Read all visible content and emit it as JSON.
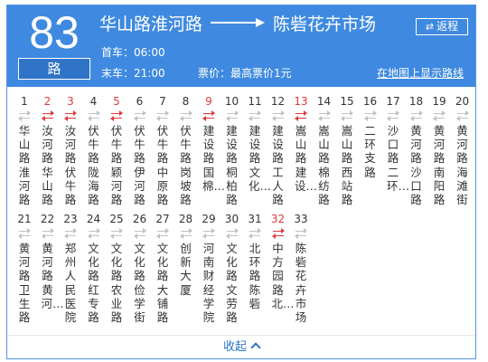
{
  "route": {
    "number": "83",
    "unit": "路",
    "from": "华山路淮河路",
    "to": "陈砦花卉市场",
    "first_bus_label": "首车：",
    "first_bus_time": "06:00",
    "last_bus_label": "末车：",
    "last_bus_time": "21:00",
    "fare_label": "票价：",
    "fare_value": "最高票价1元",
    "return_label": "返程",
    "map_link": "在地图上显示路线"
  },
  "stops": [
    {
      "num": "1",
      "name": "华山路淮河路",
      "highlight": false
    },
    {
      "num": "2",
      "name": "汝河路华山路",
      "highlight": true
    },
    {
      "num": "3",
      "name": "汝河路伏牛路",
      "highlight": true
    },
    {
      "num": "4",
      "name": "伏牛路陇海路",
      "highlight": false
    },
    {
      "num": "5",
      "name": "伏牛路颖河路",
      "highlight": true
    },
    {
      "num": "6",
      "name": "伏牛路伊河路",
      "highlight": false
    },
    {
      "num": "7",
      "name": "伏牛路中原路",
      "highlight": false
    },
    {
      "num": "8",
      "name": "伏牛路岗坡路",
      "highlight": false
    },
    {
      "num": "9",
      "name": "建设路国棉…",
      "highlight": true
    },
    {
      "num": "10",
      "name": "建设路桐柏路",
      "highlight": false
    },
    {
      "num": "11",
      "name": "建设路文化…",
      "highlight": false
    },
    {
      "num": "12",
      "name": "建设路工人路",
      "highlight": false
    },
    {
      "num": "13",
      "name": "嵩山路建设…",
      "highlight": true
    },
    {
      "num": "14",
      "name": "嵩山路棉纺路",
      "highlight": false
    },
    {
      "num": "15",
      "name": "嵩山路西站路",
      "highlight": false
    },
    {
      "num": "16",
      "name": "二环支路",
      "highlight": false
    },
    {
      "num": "17",
      "name": "沙口路二环…",
      "highlight": false
    },
    {
      "num": "18",
      "name": "黄河路沙口路",
      "highlight": false
    },
    {
      "num": "19",
      "name": "黄河路南阳路",
      "highlight": false
    },
    {
      "num": "20",
      "name": "黄河路海滩街",
      "highlight": false
    },
    {
      "num": "21",
      "name": "黄河路卫生路",
      "highlight": false
    },
    {
      "num": "22",
      "name": "黄河路黄河…",
      "highlight": false
    },
    {
      "num": "23",
      "name": "郑州人民医院",
      "highlight": false
    },
    {
      "num": "24",
      "name": "文化路红专路",
      "highlight": false
    },
    {
      "num": "25",
      "name": "文化路农业路",
      "highlight": false
    },
    {
      "num": "26",
      "name": "文化路俭学街",
      "highlight": false
    },
    {
      "num": "27",
      "name": "文化路大铺路",
      "highlight": false
    },
    {
      "num": "28",
      "name": "创新大厦",
      "highlight": false
    },
    {
      "num": "29",
      "name": "河南财经学院",
      "highlight": false
    },
    {
      "num": "30",
      "name": "文化路文劳路",
      "highlight": false
    },
    {
      "num": "31",
      "name": "北环路陈砦",
      "highlight": false
    },
    {
      "num": "32",
      "name": "中方园路北…",
      "highlight": true
    },
    {
      "num": "33",
      "name": "陈砦花卉市场",
      "highlight": false
    }
  ],
  "collapse_label": "收起",
  "colors": {
    "header_bg": "#3f8ae0",
    "accent_red": "#e2393c",
    "link_blue": "#2f74c6"
  }
}
